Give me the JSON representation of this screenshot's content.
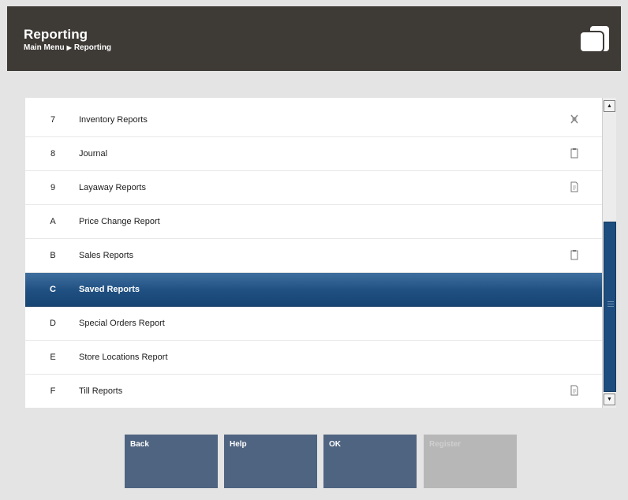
{
  "header": {
    "title": "Reporting",
    "breadcrumb": [
      "Main Menu",
      "Reporting"
    ]
  },
  "menu": {
    "items": [
      {
        "key": "7",
        "label": "Inventory Reports",
        "icon": "wrench-icon"
      },
      {
        "key": "8",
        "label": "Journal",
        "icon": "clipboard-icon"
      },
      {
        "key": "9",
        "label": "Layaway Reports",
        "icon": "document-icon"
      },
      {
        "key": "A",
        "label": "Price Change Report",
        "icon": ""
      },
      {
        "key": "B",
        "label": "Sales Reports",
        "icon": "clipboard-icon"
      },
      {
        "key": "C",
        "label": "Saved Reports",
        "icon": "",
        "selected": true
      },
      {
        "key": "D",
        "label": "Special Orders Report",
        "icon": ""
      },
      {
        "key": "E",
        "label": "Store Locations Report",
        "icon": ""
      },
      {
        "key": "F",
        "label": "Till Reports",
        "icon": "document-icon"
      }
    ]
  },
  "buttons": {
    "back": "Back",
    "help": "Help",
    "ok": "OK",
    "register": "Register"
  },
  "colors": {
    "header_bg": "#3e3a36",
    "selected_row": "#1f4f80",
    "button_bg": "#4f6480",
    "button_disabled": "#b7b7b7"
  }
}
